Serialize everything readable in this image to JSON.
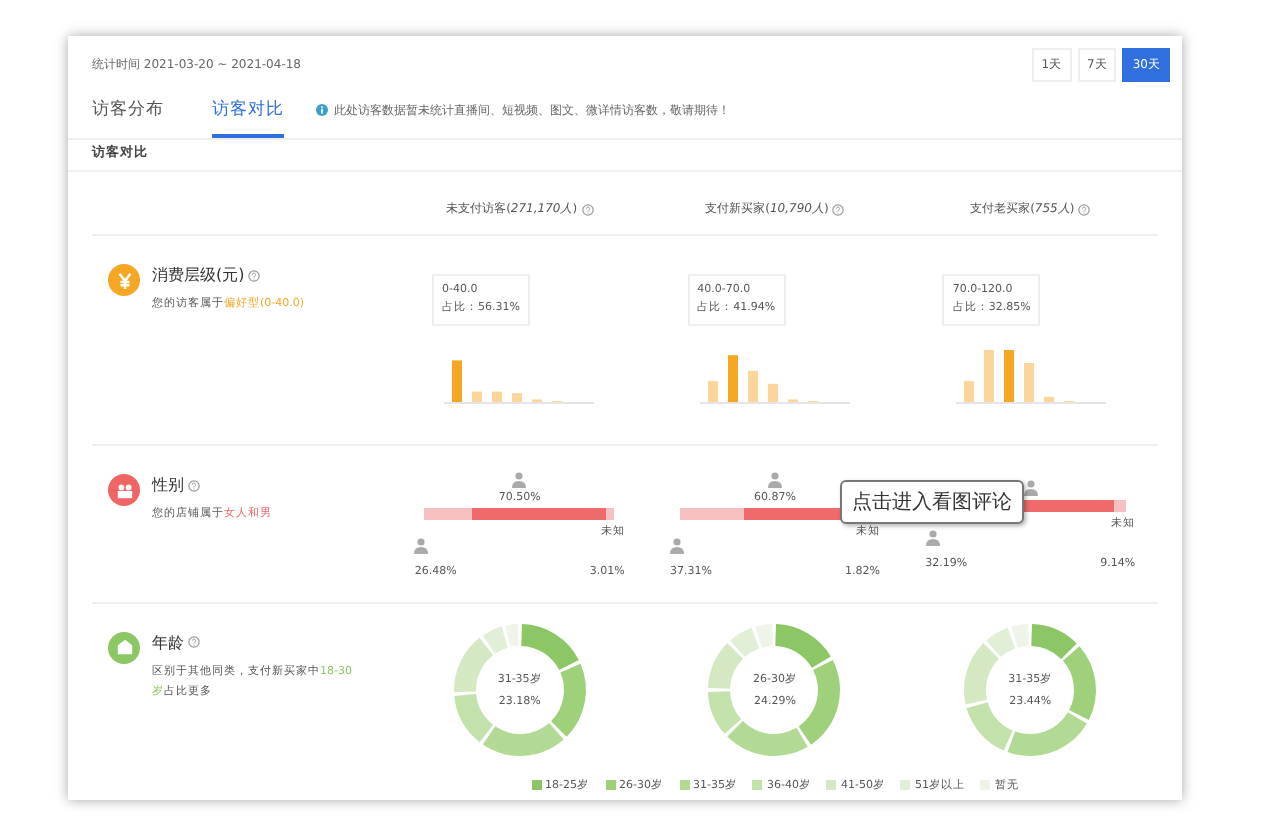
{
  "header": {
    "period": "统计时间 2021-03-20 ~ 2021-04-18",
    "ranges": [
      {
        "label": "1天",
        "selected": false
      },
      {
        "label": "7天",
        "selected": false
      },
      {
        "label": "30天",
        "selected": true
      }
    ]
  },
  "tabs": [
    {
      "label": "访客分布",
      "selected": false
    },
    {
      "label": "访客对比",
      "selected": true
    }
  ],
  "notice": "此处访客数据暂未统计直播间、短视频、图文、微详情访客数，敬请期待！",
  "section_title": "访客对比",
  "columns": [
    "未支付访客(*271,170人*)",
    "支付新买家(*10,790人*)",
    "支付老买家(*755人*)"
  ],
  "rows": [
    {
      "kind": "spend",
      "title": "消费层级(元)",
      "desc": "您的访客属于**偏好型(0-40.0)**",
      "color": "#f5a623",
      "cells": [
        {
          "range": "0-40.0",
          "share": "占比：56.31%"
        },
        {
          "range": "40.0-70.0",
          "share": "占比：41.94%"
        },
        {
          "range": "70.0-120.0",
          "share": "占比：32.85%"
        }
      ]
    },
    {
      "kind": "gender",
      "title": "性别",
      "desc": "您的店铺属于**女人和男**",
      "color": "#f06464",
      "cells": [
        {
          "female": "70.50%",
          "male": "26.48%",
          "unknown_label": "未知",
          "unknown": "3.01%",
          "level": 0.705
        },
        {
          "female": "60.87%",
          "male": "37.31%",
          "unknown_label": "未知",
          "unknown": "1.82%",
          "level": 0.609
        },
        {
          "male": "32.19%",
          "unknown_label": "未知",
          "unknown": "9.14%",
          "level": 0.58
        }
      ]
    },
    {
      "kind": "age",
      "title": "年龄",
      "desc": "区别于其他同类，支付新买家中**18-30岁**占比更多",
      "color": "#8cc665",
      "cells": [
        {
          "group": "31-35岁",
          "share": "23.18%"
        },
        {
          "group": "26-30岁",
          "share": "24.29%"
        },
        {
          "group": "31-35岁",
          "share": "23.44%"
        }
      ]
    }
  ],
  "legend": [
    {
      "label": "18-25岁",
      "color": "#8cc665"
    },
    {
      "label": "26-30岁",
      "color": "#9fd07a"
    },
    {
      "label": "31-35岁",
      "color": "#b3da95"
    },
    {
      "label": "36-40岁",
      "color": "#c3e1ab"
    },
    {
      "label": "41-50岁",
      "color": "#d3e8c3"
    },
    {
      "label": "51岁以上",
      "color": "#e2efd7"
    },
    {
      "label": "暂无",
      "color": "#eef5e8"
    }
  ],
  "tooltip": "点击进入看图评论"
}
